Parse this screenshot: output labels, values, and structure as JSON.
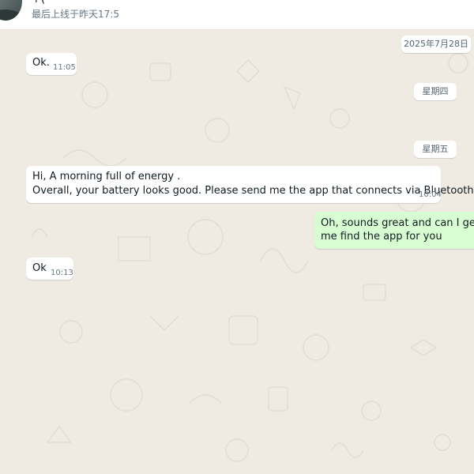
{
  "header": {
    "contact_name": "+(",
    "last_seen": "最后上线于昨天17:5"
  },
  "date_separators": {
    "date": "2025年7月28日",
    "thursday": "星期四",
    "friday": "星期五"
  },
  "messages": [
    {
      "direction": "incoming",
      "lines": [
        "Ok."
      ],
      "time": "11:05"
    },
    {
      "direction": "incoming",
      "lines": [
        "Hi, A morning full of energy .",
        "Overall, your battery looks good. Please send me the app that connects via Bluetooth."
      ],
      "time": "10:04"
    },
    {
      "direction": "outgoing",
      "lines": [
        "Oh, sounds great and can I get a p",
        "me find the app for you"
      ],
      "time": ""
    },
    {
      "direction": "incoming",
      "lines": [
        "Ok"
      ],
      "time": "10:13"
    }
  ],
  "colors": {
    "chat_background": "#efeae2",
    "incoming_bubble": "#ffffff",
    "outgoing_bubble": "#d9fdd3",
    "timestamp_text": "#667781"
  }
}
